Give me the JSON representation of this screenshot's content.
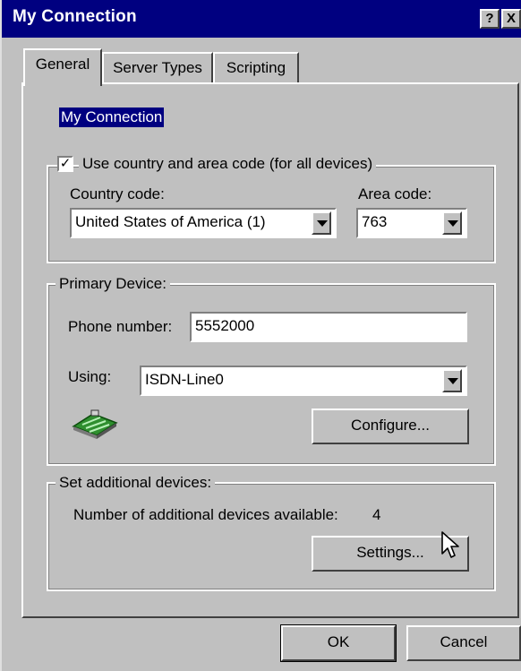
{
  "window": {
    "title": "My Connection",
    "help_glyph": "?",
    "close_glyph": "X"
  },
  "tabs": [
    {
      "label": "General",
      "active": true
    },
    {
      "label": "Server Types",
      "active": false
    },
    {
      "label": "Scripting",
      "active": false
    }
  ],
  "connection_name": "My Connection",
  "location_group": {
    "checkbox_label": "Use country and area code (for all devices)",
    "checked": true,
    "country_label": "Country code:",
    "country_value": "United States of America (1)",
    "area_label": "Area code:",
    "area_value": "763"
  },
  "primary_device": {
    "legend": "Primary Device:",
    "phone_label": "Phone number:",
    "phone_value": "5552000",
    "using_label": "Using:",
    "using_value": "ISDN-Line0",
    "configure_label": "Configure..."
  },
  "additional_devices": {
    "legend": "Set additional devices:",
    "count_label": "Number of additional devices available:",
    "count_value": "4",
    "settings_label": "Settings..."
  },
  "footer": {
    "ok_label": "OK",
    "cancel_label": "Cancel"
  },
  "icons": {
    "device": "modem-icon",
    "cursor": "mouse-pointer-icon"
  }
}
